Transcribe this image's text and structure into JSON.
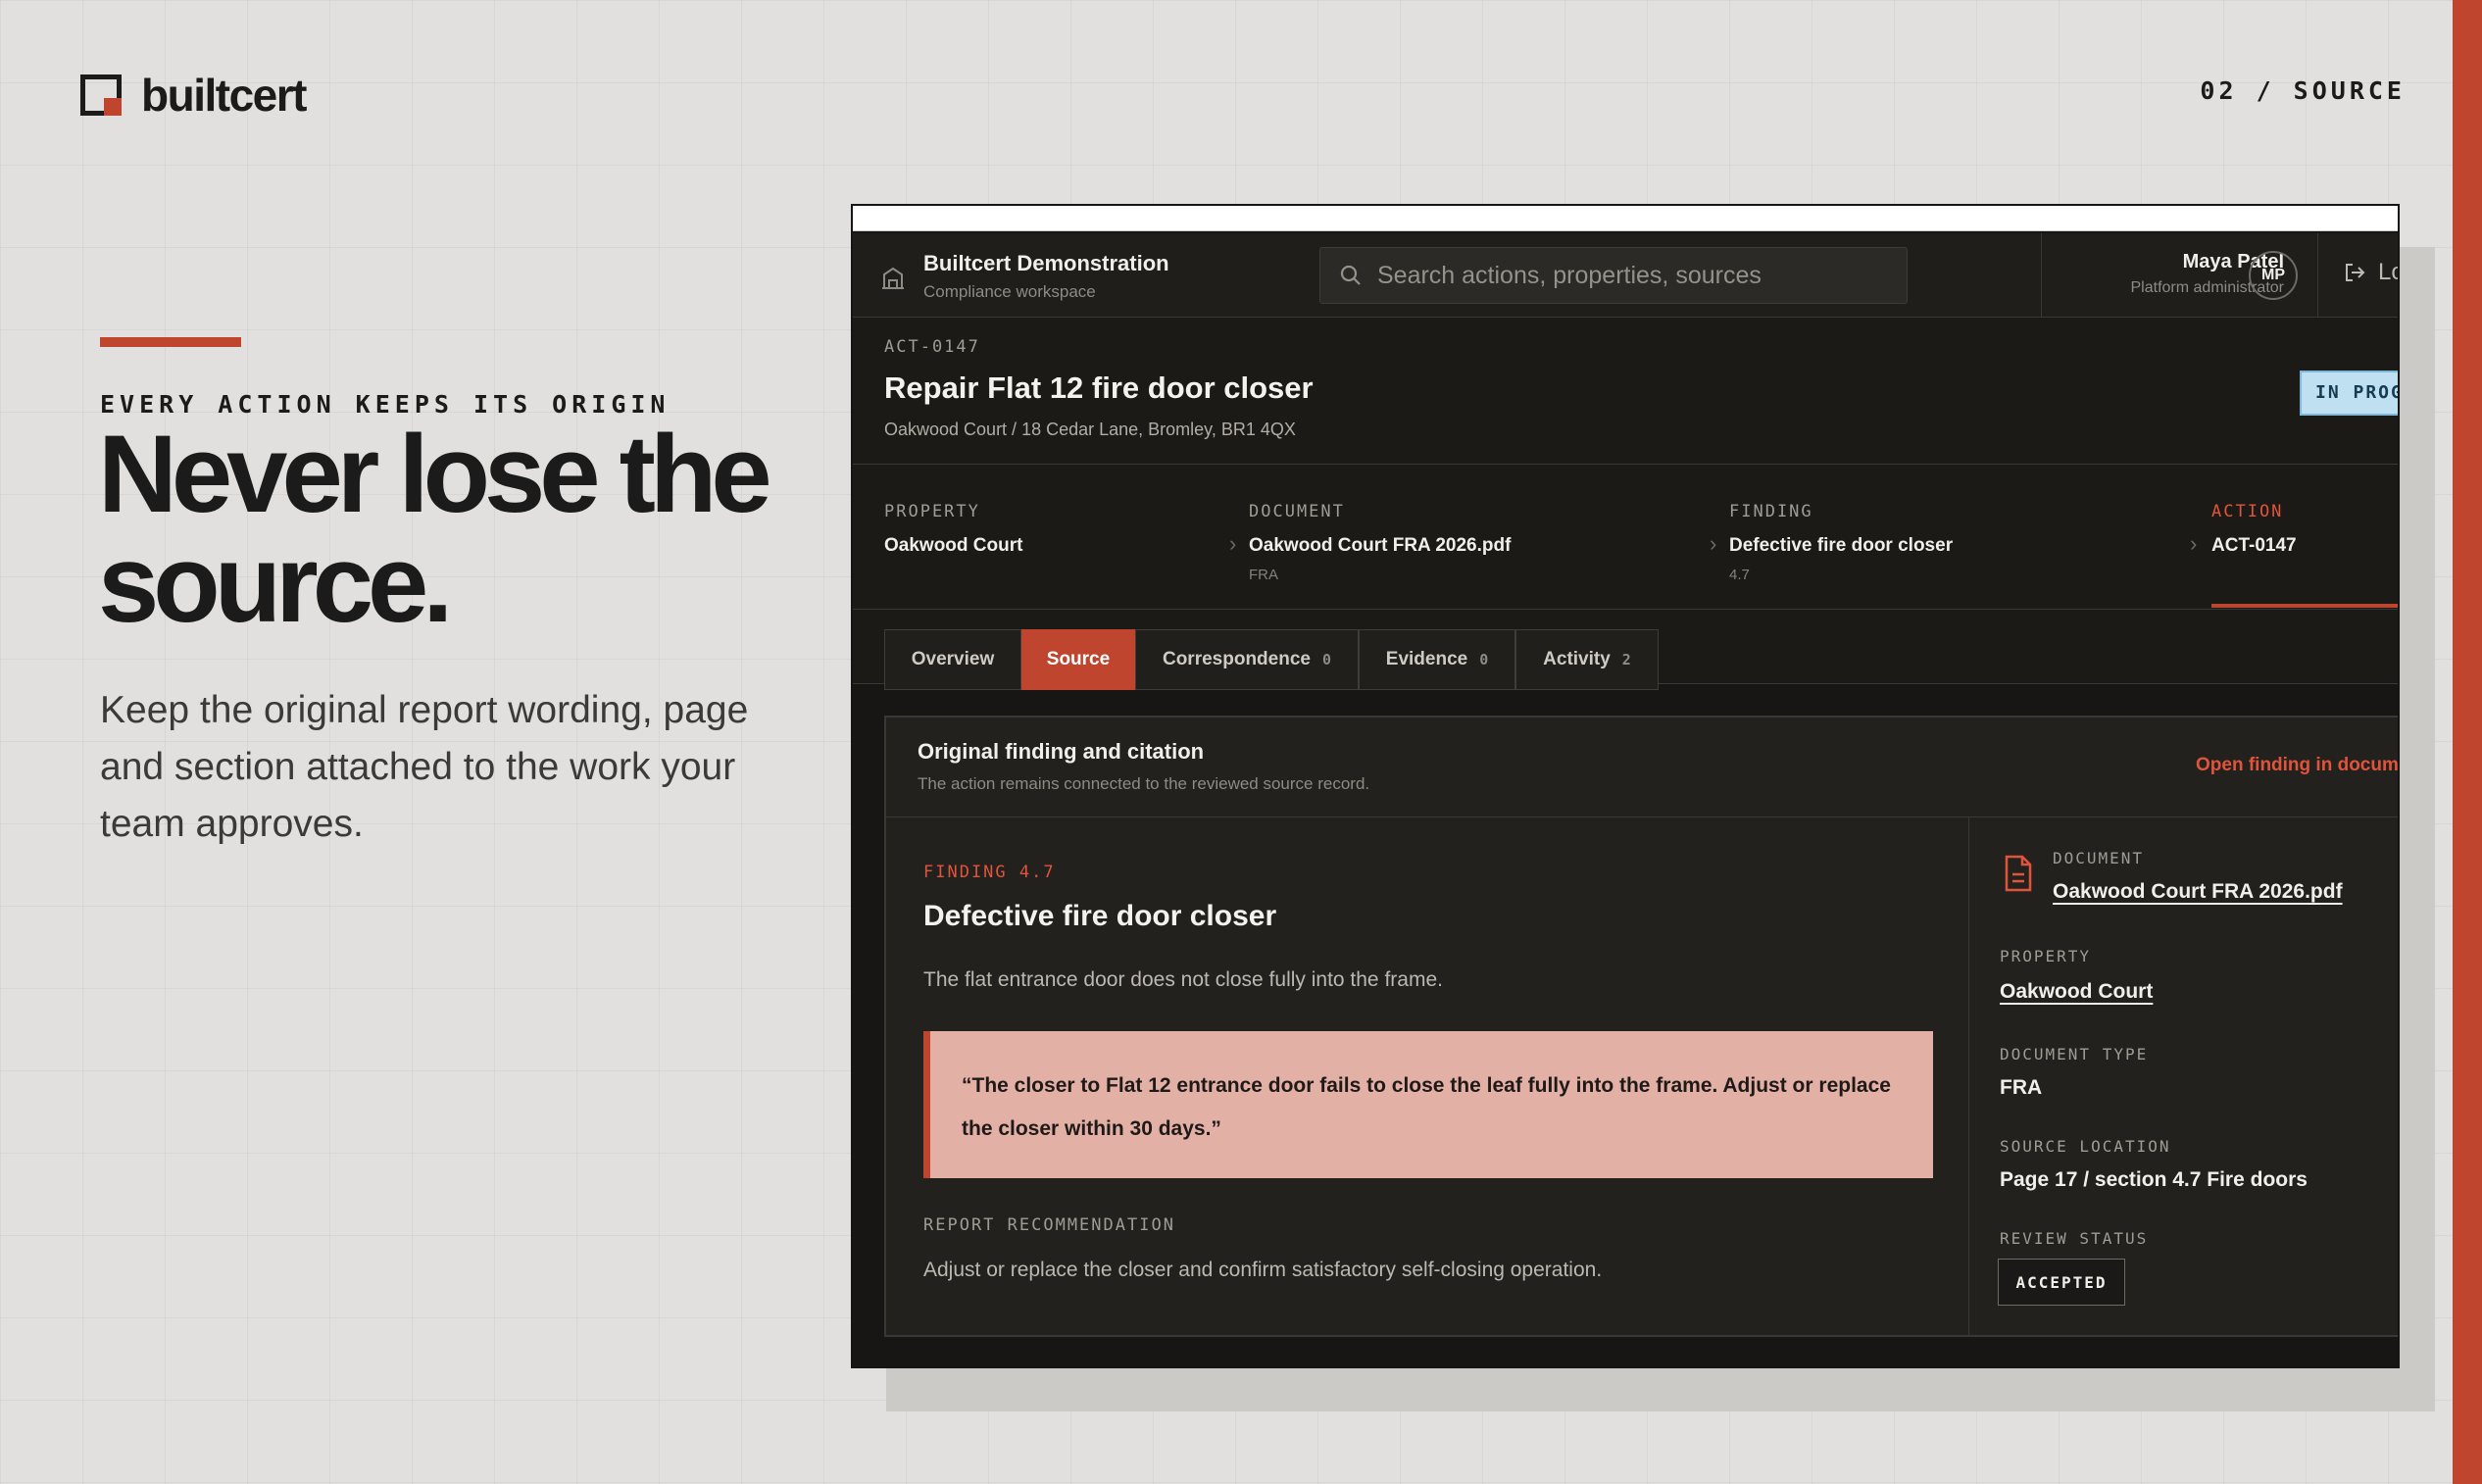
{
  "brand": {
    "name": "builtcert",
    "accent": "#c0452e"
  },
  "slide": {
    "index": "02 / SOURCE"
  },
  "hero": {
    "kicker": "EVERY ACTION KEEPS ITS ORIGIN",
    "headline_line1": "Never lose the",
    "headline_line2": "source.",
    "lede": "Keep the original report wording, page and section attached to the work your team approves."
  },
  "app": {
    "workspace": {
      "name": "Builtcert Demonstration",
      "subtitle": "Compliance workspace",
      "icon": "building-icon"
    },
    "search": {
      "placeholder": "Search actions, properties, sources",
      "value": ""
    },
    "user": {
      "name": "Maya Patel",
      "role": "Platform administrator",
      "initials": "MP"
    },
    "logout_label": "Lo",
    "action": {
      "id": "ACT-0147",
      "title": "Repair Flat 12 fire door closer",
      "address": "Oakwood Court / 18 Cedar Lane, Bromley, BR1 4QX",
      "status": "IN PROG",
      "status_color": "#bfe0f1"
    },
    "breadcrumbs": [
      {
        "label": "PROPERTY",
        "value": "Oakwood Court",
        "sub": ""
      },
      {
        "label": "DOCUMENT",
        "value": "Oakwood Court FRA 2026.pdf",
        "sub": "FRA"
      },
      {
        "label": "FINDING",
        "value": "Defective fire door closer",
        "sub": "4.7"
      },
      {
        "label": "ACTION",
        "value": "ACT-0147",
        "sub": ""
      }
    ],
    "tabs": [
      {
        "label": "Overview",
        "count": ""
      },
      {
        "label": "Source",
        "count": ""
      },
      {
        "label": "Correspondence",
        "count": "0"
      },
      {
        "label": "Evidence",
        "count": "0"
      },
      {
        "label": "Activity",
        "count": "2"
      }
    ],
    "active_tab": "Source",
    "panel": {
      "title": "Original finding and citation",
      "subtitle": "The action remains connected to the reviewed source record.",
      "open_link": "Open finding in docum",
      "finding_number": "FINDING 4.7",
      "finding_title": "Defective fire door closer",
      "finding_description": "The flat entrance door does not close fully into the frame.",
      "quote": "“The closer to Flat 12 entrance door fails to close the leaf fully into the frame. Adjust or replace the closer within 30 days.”",
      "recommendation_label": "REPORT RECOMMENDATION",
      "recommendation": "Adjust or replace the closer and confirm satisfactory self-closing operation."
    },
    "meta": {
      "document_label": "DOCUMENT",
      "document": "Oakwood Court FRA 2026.pdf",
      "property_label": "PROPERTY",
      "property": "Oakwood Court",
      "doc_type_label": "DOCUMENT TYPE",
      "doc_type": "FRA",
      "source_location_label": "SOURCE LOCATION",
      "source_location": "Page 17 / section 4.7 Fire doors",
      "review_status_label": "REVIEW STATUS",
      "review_status": "ACCEPTED"
    }
  }
}
